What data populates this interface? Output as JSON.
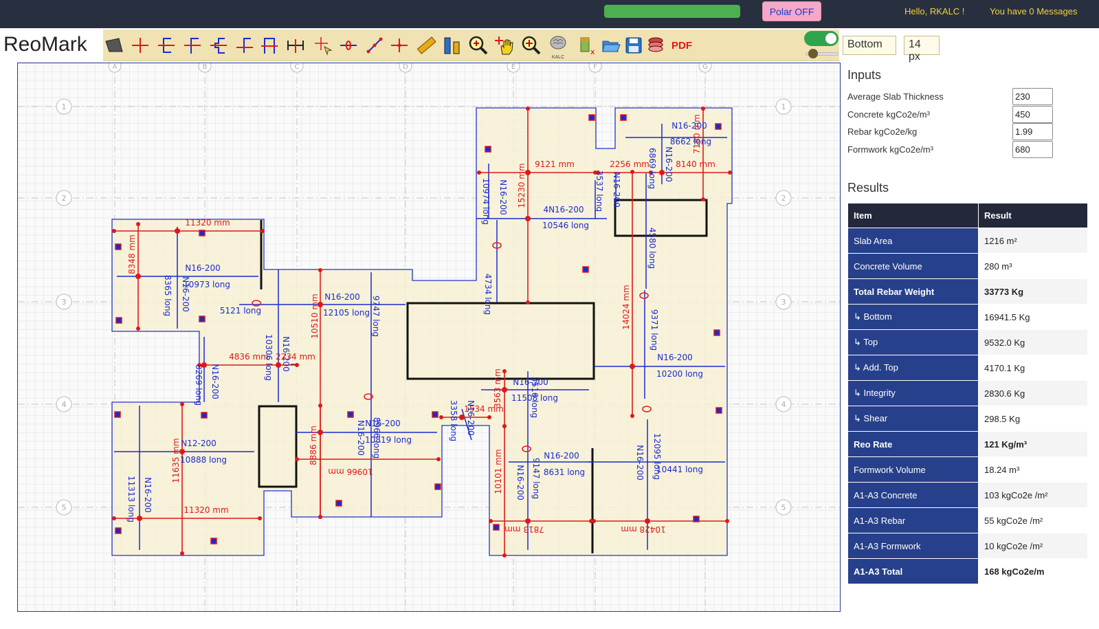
{
  "topbar": {
    "polar_label": "Polar OFF",
    "greeting": "Hello, RKALC !",
    "messages": "You have 0 Messages",
    "progress_color": "#4cb050"
  },
  "brand": "ReoMark",
  "toolbar": {
    "tools": [
      "select-slab-icon",
      "bar-cross-icon",
      "bar-bracket-icon",
      "bar-hook-icon",
      "bar-crank-icon",
      "bar-lap-icon",
      "bar-stirrup-icon",
      "dimension-icon",
      "cursor-cross-icon",
      "bar-circle-icon",
      "measure-line-icon",
      "bar-arrows-icon",
      "ruler-icon",
      "level-icon",
      "zoom-in-icon",
      "pan-hand-icon",
      "zoom-fit-icon",
      "kalc-brain-icon",
      "clear-icon",
      "open-folder-icon",
      "save-icon",
      "layers-icon",
      "pdf-icon"
    ],
    "kalc_label": "KALC",
    "pdf_label": "PDF",
    "layer_value": "Bottom",
    "size_value": "14 px"
  },
  "drawing": {
    "grid_columns": [
      "A",
      "B",
      "C",
      "D",
      "E",
      "F",
      "G"
    ],
    "grid_rows": [
      "1",
      "2",
      "3",
      "4",
      "5"
    ],
    "dims": [
      {
        "t": "11320 mm"
      },
      {
        "t": "8348 mm"
      },
      {
        "t": "9121 mm"
      },
      {
        "t": "2256 mm"
      },
      {
        "t": "8140 mm"
      },
      {
        "t": "15230 mm"
      },
      {
        "t": "7180 mm"
      },
      {
        "t": "10510 mm"
      },
      {
        "t": "14024 mm"
      },
      {
        "t": "4836 mm"
      },
      {
        "t": "2234 mm"
      },
      {
        "t": "11635 mm"
      },
      {
        "t": "11320 mm"
      },
      {
        "t": "8886 mm"
      },
      {
        "t": "10966 mm"
      },
      {
        "t": "3563 mm"
      },
      {
        "t": "1534 mm"
      },
      {
        "t": "10101 mm"
      },
      {
        "t": "7813 mm"
      },
      {
        "t": "10428 mm"
      }
    ],
    "bars": [
      {
        "t": "N16-200"
      },
      {
        "t": "8662 long"
      },
      {
        "t": "N16-200"
      },
      {
        "t": "6869 long"
      },
      {
        "t": "10974 long"
      },
      {
        "t": "N16-200"
      },
      {
        "t": "3537 long"
      },
      {
        "t": "N16-200"
      },
      {
        "t": "4N16-200"
      },
      {
        "t": "10546 long"
      },
      {
        "t": "4580 long"
      },
      {
        "t": "N16-200"
      },
      {
        "t": "10973 long"
      },
      {
        "t": "8365 long"
      },
      {
        "t": "N16-200"
      },
      {
        "t": "5121 long"
      },
      {
        "t": "N16-200"
      },
      {
        "t": "12105 long"
      },
      {
        "t": "9747 long"
      },
      {
        "t": "4734 long"
      },
      {
        "t": "9371 long"
      },
      {
        "t": "N16-200"
      },
      {
        "t": "10200 long"
      },
      {
        "t": "10306 long"
      },
      {
        "t": "N16-200"
      },
      {
        "t": "8269 long"
      },
      {
        "t": "N16-200"
      },
      {
        "t": "N16-200"
      },
      {
        "t": "11508 long"
      },
      {
        "t": "5516 long"
      },
      {
        "t": "N12-200"
      },
      {
        "t": "10888 long"
      },
      {
        "t": "N16-200"
      },
      {
        "t": "10819 long"
      },
      {
        "t": "N16-200"
      },
      {
        "t": "8966 long"
      },
      {
        "t": "3358 long"
      },
      {
        "t": "N16-200"
      },
      {
        "t": "N16-200"
      },
      {
        "t": "8631 long"
      },
      {
        "t": "N16-200"
      },
      {
        "t": "9147 long"
      },
      {
        "t": "N16-200"
      },
      {
        "t": "12095 long"
      },
      {
        "t": "10441 long"
      },
      {
        "t": "11313 long"
      },
      {
        "t": "N16-200"
      }
    ]
  },
  "inputs": {
    "title": "Inputs",
    "rows": [
      {
        "label": "Average Slab Thickness",
        "value": "230"
      },
      {
        "label": "Concrete kgCo2e/m³",
        "value": "450"
      },
      {
        "label": "Rebar kgCo2e/kg",
        "value": "1.99"
      },
      {
        "label": "Formwork kgCo2e/m³",
        "value": "680"
      }
    ]
  },
  "results": {
    "title": "Results",
    "headers": [
      "Item",
      "Result"
    ],
    "rows": [
      {
        "item": "Slab Area",
        "result": "1216 m²",
        "bold": false
      },
      {
        "item": "Concrete Volume",
        "result": "280 m³",
        "bold": false
      },
      {
        "item": "Total Rebar Weight",
        "result": "33773 Kg",
        "bold": true
      },
      {
        "item": "↳ Bottom",
        "result": "16941.5 Kg",
        "bold": false
      },
      {
        "item": "↳ Top",
        "result": "9532.0 Kg",
        "bold": false
      },
      {
        "item": "↳ Add. Top",
        "result": "4170.1 Kg",
        "bold": false
      },
      {
        "item": "↳ Integrity",
        "result": "2830.6 Kg",
        "bold": false
      },
      {
        "item": "↳ Shear",
        "result": "298.5 Kg",
        "bold": false
      },
      {
        "item": "Reo Rate",
        "result": "121 Kg/m³",
        "bold": true
      },
      {
        "item": "Formwork Volume",
        "result": "18.24 m³",
        "bold": false
      },
      {
        "item": "A1-A3 Concrete",
        "result": "103 kgCo2e /m²",
        "bold": false
      },
      {
        "item": "A1-A3 Rebar",
        "result": "55 kgCo2e /m²",
        "bold": false
      },
      {
        "item": "A1-A3 Formwork",
        "result": "10 kgCo2e /m²",
        "bold": false
      },
      {
        "item": "A1-A3 Total",
        "result": "168 kgCo2e/m",
        "bold": true
      }
    ]
  }
}
